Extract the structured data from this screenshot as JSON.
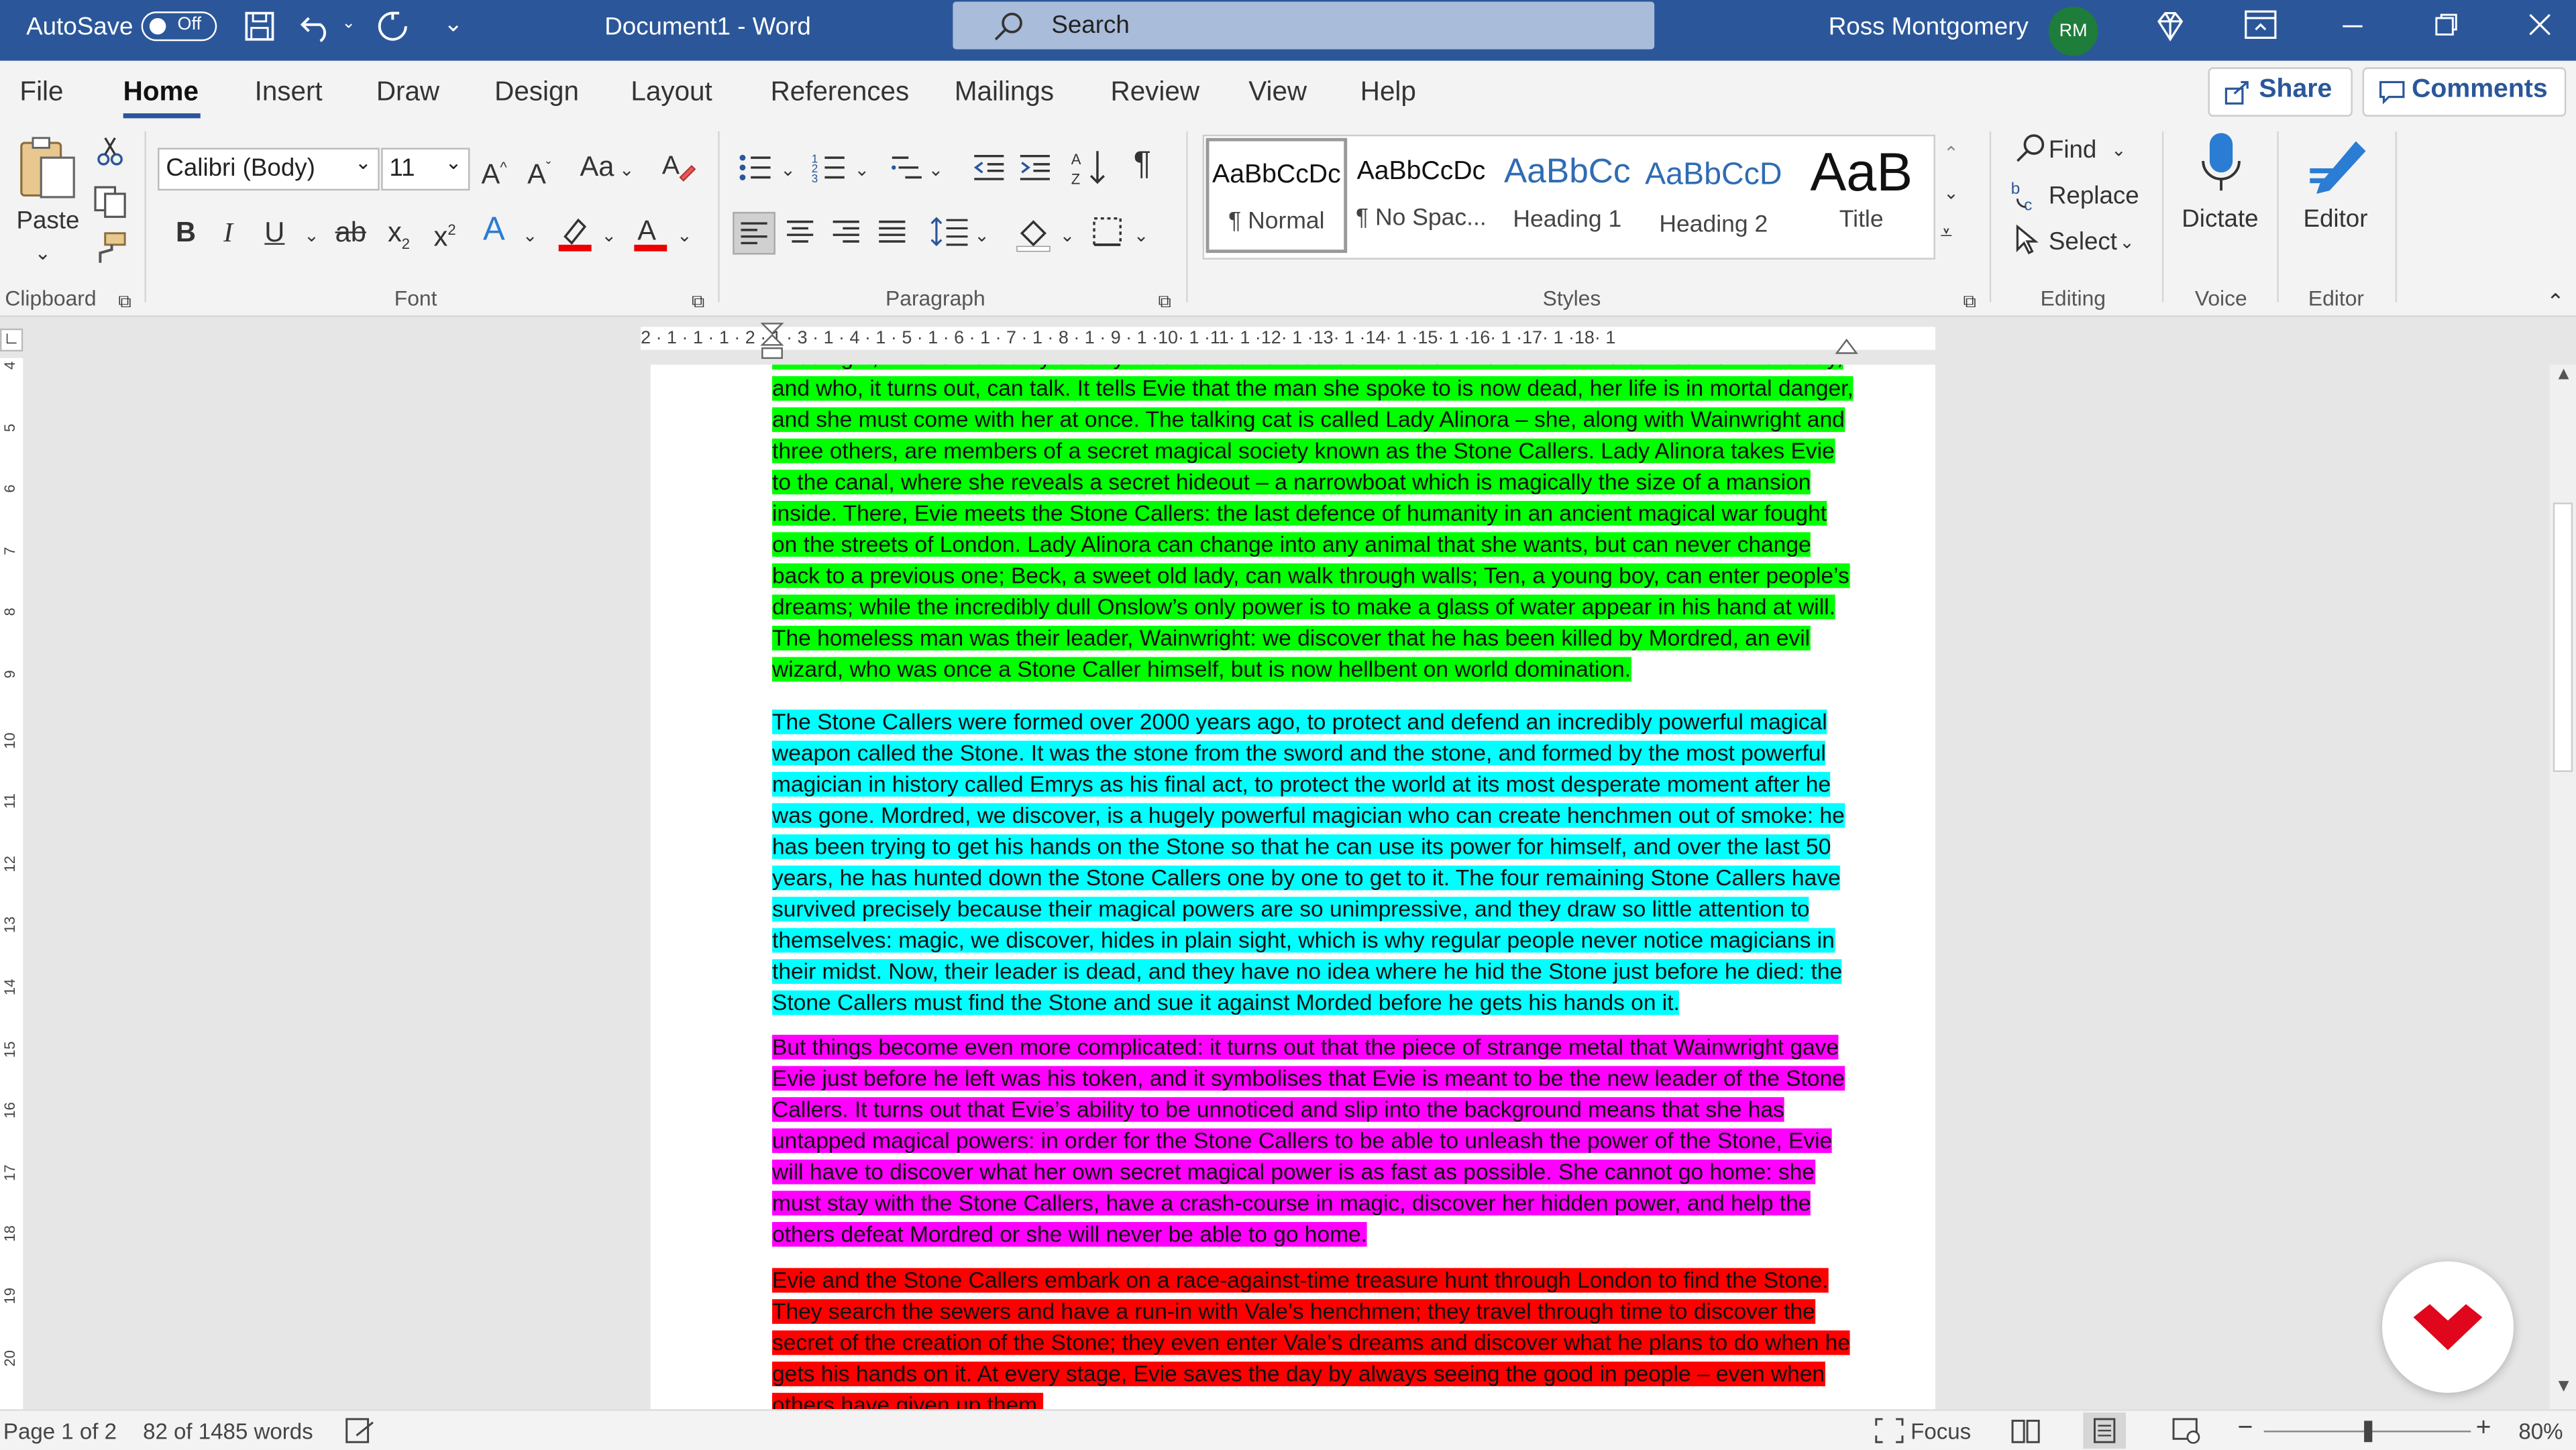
{
  "titlebar": {
    "autosave_label": "AutoSave",
    "autosave_state": "Off",
    "doc_title": "Document1  -  Word",
    "search_placeholder": "Search",
    "user_name": "Ross Montgomery",
    "user_initials": "RM"
  },
  "tabs": [
    "File",
    "Home",
    "Insert",
    "Draw",
    "Design",
    "Layout",
    "References",
    "Mailings",
    "Review",
    "View",
    "Help"
  ],
  "active_tab": "Home",
  "share_label": "Share",
  "comments_label": "Comments",
  "ribbon": {
    "clipboard": {
      "paste": "Paste",
      "group": "Clipboard"
    },
    "font": {
      "family": "Calibri (Body)",
      "size": "11",
      "change_case": "Aa",
      "group": "Font"
    },
    "paragraph": {
      "group": "Paragraph"
    },
    "styles": {
      "items": [
        {
          "preview": "AaBbCcDc",
          "name": "¶ Normal"
        },
        {
          "preview": "AaBbCcDc",
          "name": "¶ No Spac..."
        },
        {
          "preview": "AaBbCc",
          "name": "Heading 1"
        },
        {
          "preview": "AaBbCcD",
          "name": "Heading 2"
        },
        {
          "preview": "AaB",
          "name": "Title"
        }
      ],
      "group": "Styles"
    },
    "editing": {
      "find": "Find",
      "replace": "Replace",
      "select": "Select",
      "group": "Editing"
    },
    "voice": {
      "dictate": "Dictate",
      "group": "Voice"
    },
    "editor": {
      "editor": "Editor",
      "group": "Editor"
    }
  },
  "ruler_text": "2 · 1 · 1 · 1 · 2 · 1 · 3 · 1 · 4 · 1 · 5 · 1 · 6 · 1 · 7 · 1 · 8 · 1 · 9 · 1 ·10· 1 ·11· 1 ·12· 1 ·13· 1 ·14· 1 ·15· 1 ·16· 1 ·17· 1 ·18· 1",
  "document": {
    "highlight_colors": {
      "green": "#00ff00",
      "cyan": "#00ffff",
      "magenta": "#ff00ff",
      "red": "#ff0000"
    },
    "paragraphs": [
      {
        "highlight": "green",
        "text": "That night, Evie is visited by a stray black cat at her bedroom window – one who Evie saw earlier in the day, and who, it turns out, can talk. It tells Evie that the man she spoke to is now dead, her life is in mortal danger, and she must come with her at once. The talking cat is called Lady Alinora – she, along with Wainwright and three others, are members of a secret magical society known as the Stone Callers. Lady Alinora takes Evie to the canal, where she reveals a secret hideout – a narrowboat which is magically the size of a mansion inside. There, Evie meets the Stone Callers: the last defence of humanity in an ancient magical war fought on the streets of London. Lady Alinora can change into any animal that she wants, but can never change back to a previous one; Beck, a sweet old lady, can walk through walls; Ten, a young boy, can enter people’s dreams; while the incredibly dull Onslow’s only power is to make a glass of water appear in his hand at will. The homeless man was their leader, Wainwright: we discover that he has been killed by Mordred, an evil wizard, who was once a Stone Caller himself, but is now hellbent on world domination."
      },
      {
        "highlight": "cyan",
        "text": "The Stone Callers were formed over 2000 years ago, to protect and defend an incredibly powerful magical weapon called the Stone. It was the stone from the sword and the stone, and formed by the most powerful magician in history called Emrys as his final act, to protect the world at its most desperate moment after he was gone. Mordred, we discover, is a hugely powerful magician who can create henchmen out of smoke: he has been trying to get his hands on the Stone so that he can use its power for himself, and over the last 50 years, he has hunted down the Stone Callers one by one to get to it. The four remaining Stone Callers have survived precisely because their magical powers are so unimpressive, and they draw so little attention to themselves: magic, we discover, hides in plain sight, which is why regular people never notice magicians in their midst. Now, their leader is dead, and they have no idea where he hid the Stone just before he died: the Stone Callers must find the Stone and sue it against Morded before he gets his hands on it."
      },
      {
        "highlight": "magenta",
        "text": "But things become even more complicated: it turns out that the piece of strange metal that Wainwright gave Evie just before he left was his token, and it symbolises that Evie is meant to be the new leader of the Stone Callers. It turns out that Evie’s ability to be unnoticed and slip into the background means that she has untapped magical powers: in order for the Stone Callers to be able to unleash the power of the Stone, Evie will have to discover what her own secret magical power is as fast as possible. She cannot go home: she must stay with the Stone Callers, have a crash-course in magic, discover her hidden power, and help the others defeat Mordred or she will never be able to go home."
      },
      {
        "highlight": "red",
        "text": "Evie and the Stone Callers embark on a race-against-time treasure hunt through London to find the Stone. They search the sewers and have a run-in with Vale’s henchmen; they travel through time to discover the secret of the creation of the Stone; they even enter Vale’s dreams and discover what he plans to do when he gets his hands on it. At every stage, Evie saves the day by always seeing the good in people – even when others have given up them."
      }
    ]
  },
  "status": {
    "page": "Page 1 of 2",
    "words": "82 of 1485 words",
    "focus": "Focus",
    "zoom": "80%",
    "zoom_fraction": 0.5
  }
}
